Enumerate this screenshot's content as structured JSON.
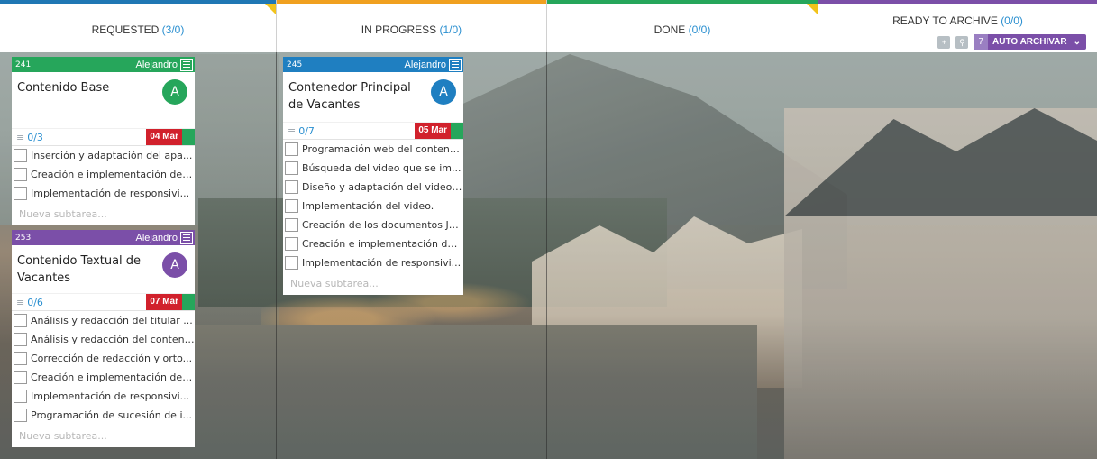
{
  "columns": [
    {
      "title": "REQUESTED",
      "count": "(3/0)",
      "color": "#1f77b4"
    },
    {
      "title": "IN PROGRESS",
      "count": "(1/0)",
      "color": "#f0a020"
    },
    {
      "title": "DONE",
      "count": "(0/0)",
      "color": "#26a65b"
    },
    {
      "title": "READY TO ARCHIVE",
      "count": "(0/0)",
      "color": "#7b4fa8"
    }
  ],
  "archive_tools": {
    "add_icon": "plus-icon",
    "search_icon": "search-icon",
    "auto_count": "7",
    "auto_label": "AUTO ARCHIVAR",
    "chevron": "chevron-down-icon"
  },
  "cards": [
    {
      "id": "241",
      "owner": "Alejandro",
      "header_color": "#26a65b",
      "title": "Contenido Base",
      "avatar": "A",
      "avatar_color": "#26a65b",
      "progress": "0/3",
      "due": "04 Mar",
      "subtasks": [
        "Inserción y adaptación del apa...",
        "Creación e implementación de ...",
        "Implementación de responsivi..."
      ],
      "new_subtask": "Nueva subtarea..."
    },
    {
      "id": "253",
      "owner": "Alejandro",
      "header_color": "#7b4fa8",
      "title": "Contenido Textual de Vacantes",
      "avatar": "A",
      "avatar_color": "#7b4fa8",
      "progress": "0/6",
      "due": "07 Mar",
      "subtasks": [
        "Análisis y redacción del titular ...",
        "Análisis y redacción del conteni...",
        "Corrección de redacción y orto...",
        "Creación e implementación de ...",
        "Implementación de responsivi...",
        "Programación de sucesión de i..."
      ],
      "new_subtask": "Nueva subtarea..."
    },
    {
      "id": "245",
      "owner": "Alejandro",
      "header_color": "#1f7fc1",
      "title": "Contenedor Principal de Vacantes",
      "avatar": "A",
      "avatar_color": "#1f7fc1",
      "progress": "0/7",
      "due": "05 Mar",
      "subtasks": [
        "Programación web del contene...",
        "Búsqueda del video que se im...",
        "Diseño y adaptación del video ...",
        "Implementación del video.",
        "Creación de los documentos Ja...",
        "Creación e implementación de ...",
        "Implementación de responsivi..."
      ],
      "new_subtask": "Nueva subtarea..."
    }
  ]
}
